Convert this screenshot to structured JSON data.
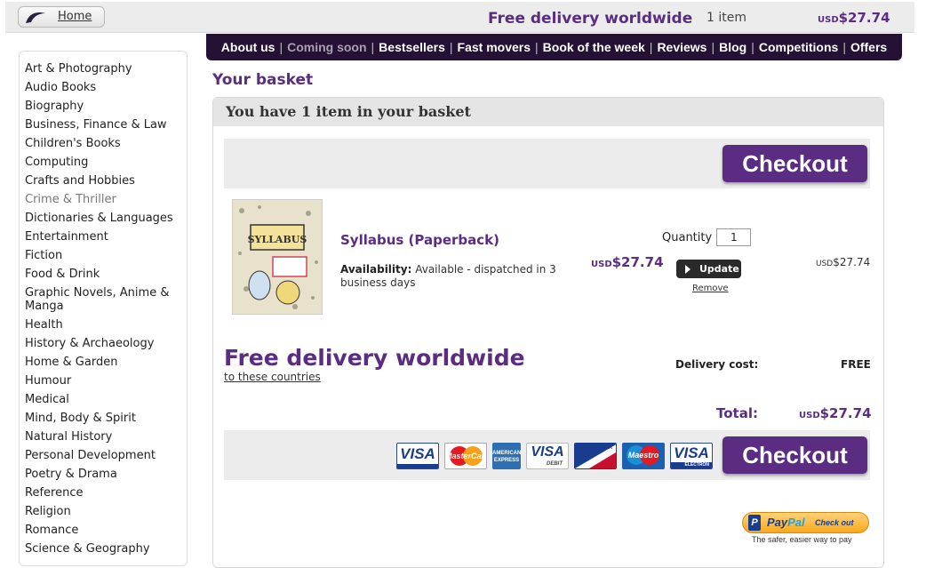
{
  "topbar": {
    "home_label": "Home",
    "free_delivery": "Free delivery worldwide",
    "item_count": "1 item",
    "currency": "USD",
    "total": "$27.74"
  },
  "nav": {
    "items": [
      "About us",
      "Coming soon",
      "Bestsellers",
      "Fast movers",
      "Book of the week",
      "Reviews",
      "Blog",
      "Competitions",
      "Offers"
    ],
    "separator": "|"
  },
  "sidebar": {
    "items": [
      "Art & Photography",
      "Audio Books",
      "Biography",
      "Business, Finance & Law",
      "Children's Books",
      "Computing",
      "Crafts and Hobbies",
      "Crime & Thriller",
      "Dictionaries & Languages",
      "Entertainment",
      "Fiction",
      "Food & Drink",
      "Graphic Novels, Anime & Manga",
      "Health",
      "History & Archaeology",
      "Home & Garden",
      "Humour",
      "Medical",
      "Mind, Body & Spirit",
      "Natural History",
      "Personal Development",
      "Poetry & Drama",
      "Reference",
      "Religion",
      "Romance",
      "Science & Geography"
    ]
  },
  "basket": {
    "title": "Your basket",
    "header": "You have 1 item in your basket",
    "checkout_label": "Checkout",
    "product": {
      "cover_text": "SYLLABUS",
      "title": "Syllabus (Paperback)",
      "availability_label": "Availability:",
      "availability_text": "Available - dispatched in 3 business days",
      "quantity_label": "Quantity",
      "quantity_value": "1",
      "currency": "USD",
      "price": "$27.74",
      "update_label": "Update",
      "remove_label": "Remove",
      "line_total": "$27.74"
    },
    "free_delivery": "Free delivery worldwide",
    "countries_link": "to these countries",
    "delivery_cost_label": "Delivery cost:",
    "delivery_cost_value": "FREE",
    "total_label": "Total:",
    "total_currency": "USD",
    "total_value": "$27.74",
    "cards": {
      "visa": "VISA",
      "mastercard": "MasterCard",
      "amex": "AMERICAN EXPRESS",
      "visa_debit": "VISA",
      "visa_debit_sub": "DEBIT",
      "delta": "DELTA",
      "maestro": "Maestro",
      "visa_electron": "VISA",
      "visa_electron_sub": "ELECTRON"
    },
    "paypal": {
      "pay": "Pay",
      "pal": "Pal",
      "checkout": "Check out",
      "caption": "The safer, easier way to pay"
    }
  }
}
